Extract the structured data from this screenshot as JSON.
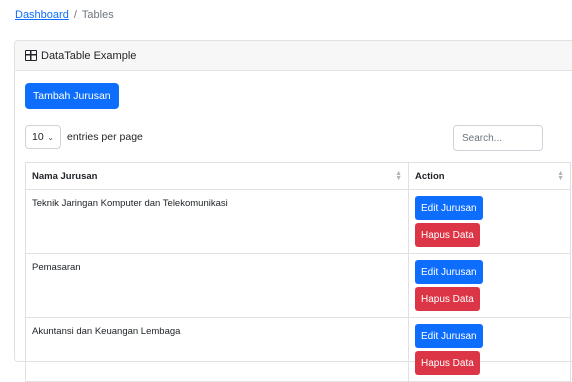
{
  "breadcrumb": {
    "link": "Dashboard",
    "separator": "/",
    "current": "Tables"
  },
  "card": {
    "title": "DataTable Example",
    "icon": "table-icon"
  },
  "add_button": "Tambah Jurusan",
  "entries": {
    "value": "10",
    "label": "entries per page"
  },
  "search": {
    "placeholder": "Search..."
  },
  "table": {
    "headers": [
      "Nama Jurusan",
      "Action"
    ],
    "rows": [
      {
        "name": "Teknik Jaringan Komputer dan Telekomunikasi",
        "edit": "Edit Jurusan",
        "delete": "Hapus Data"
      },
      {
        "name": "Pemasaran",
        "edit": "Edit Jurusan",
        "delete": "Hapus Data"
      },
      {
        "name": "Akuntansi dan Keuangan Lembaga",
        "edit": "Edit Jurusan",
        "delete": "Hapus Data"
      }
    ]
  },
  "colors": {
    "primary": "#0d6efd",
    "danger": "#dc3545"
  }
}
